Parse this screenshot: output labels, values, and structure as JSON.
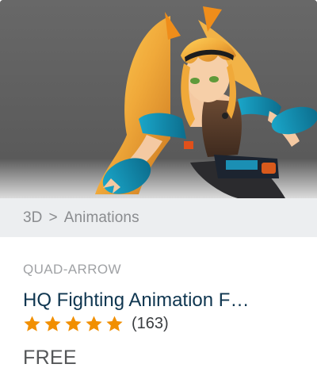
{
  "card": {
    "category": {
      "parent": "3D",
      "separator": ">",
      "child": "Animations"
    },
    "publisher": "QUAD-ARROW",
    "title": "HQ Fighting Animation F…",
    "rating": {
      "stars": 5,
      "max_stars": 5,
      "count_text": "(163)"
    },
    "price": "FREE"
  },
  "colors": {
    "title": "#0f3650",
    "star": "#f18f00",
    "category_bg": "#eceef0",
    "thumb_bg": "#5f5f5f"
  },
  "icons": {
    "star": "star-icon"
  }
}
